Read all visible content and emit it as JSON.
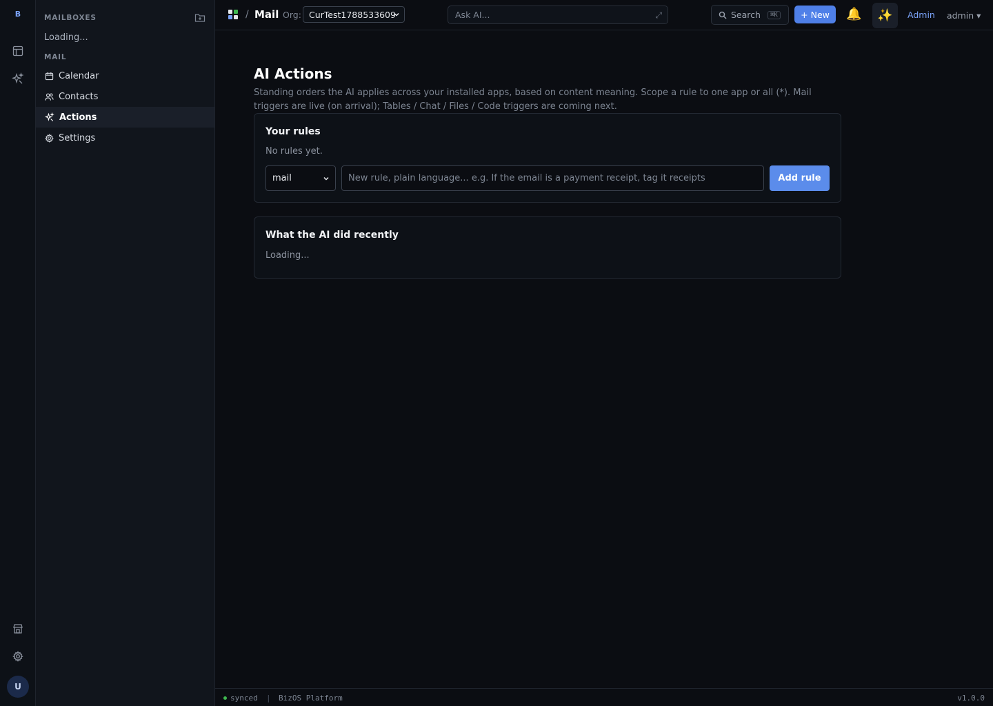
{
  "rail": {
    "logo": "B",
    "avatar": "U",
    "icons": [
      "tables-icon",
      "ai-actions-icon",
      "store-icon",
      "gear-icon"
    ]
  },
  "sidebar": {
    "mailboxes_heading": "MAILBOXES",
    "mailboxes_loading": "Loading...",
    "section_heading": "MAIL",
    "items": [
      {
        "label": "Calendar",
        "icon": "calendar-icon",
        "active": false
      },
      {
        "label": "Contacts",
        "icon": "contacts-icon",
        "active": false
      },
      {
        "label": "Actions",
        "icon": "sparkles-icon",
        "active": true
      },
      {
        "label": "Settings",
        "icon": "gear-icon",
        "active": false
      }
    ]
  },
  "topbar": {
    "separator": "/",
    "app_name": "Mail",
    "org_label": "Org:",
    "org_value": "CurTest1788533609",
    "ask_placeholder": "Ask AI...",
    "ask_expand": "⤢",
    "search_label": "Search",
    "search_shortcut": "⌘K",
    "new_label": "+ New",
    "bell": "🔔",
    "sparkle": "✨",
    "admin_link": "Admin",
    "user_menu": "admin ▾"
  },
  "main": {
    "title": "AI Actions",
    "description": "Standing orders the AI applies across your installed apps, based on content meaning. Scope a rule to one app or all (*). Mail triggers are live (on arrival); Tables / Chat / Files / Code triggers are coming next.",
    "rules_card": {
      "title": "Your rules",
      "empty_text": "No rules yet.",
      "app_select_value": "mail",
      "rule_placeholder": "New rule, plain language... e.g. If the email is a payment receipt, tag it receipts",
      "add_button": "Add rule"
    },
    "recent_card": {
      "title": "What the AI did recently",
      "loading_text": "Loading..."
    }
  },
  "statusbar": {
    "sync_state": "synced",
    "separator": "|",
    "platform": "BizOS Platform",
    "version": "v1.0.0"
  },
  "colors": {
    "accent": "#4f80e8",
    "background": "#0b0d12",
    "sidebar": "#11151c",
    "status_ok": "#3fb950"
  }
}
